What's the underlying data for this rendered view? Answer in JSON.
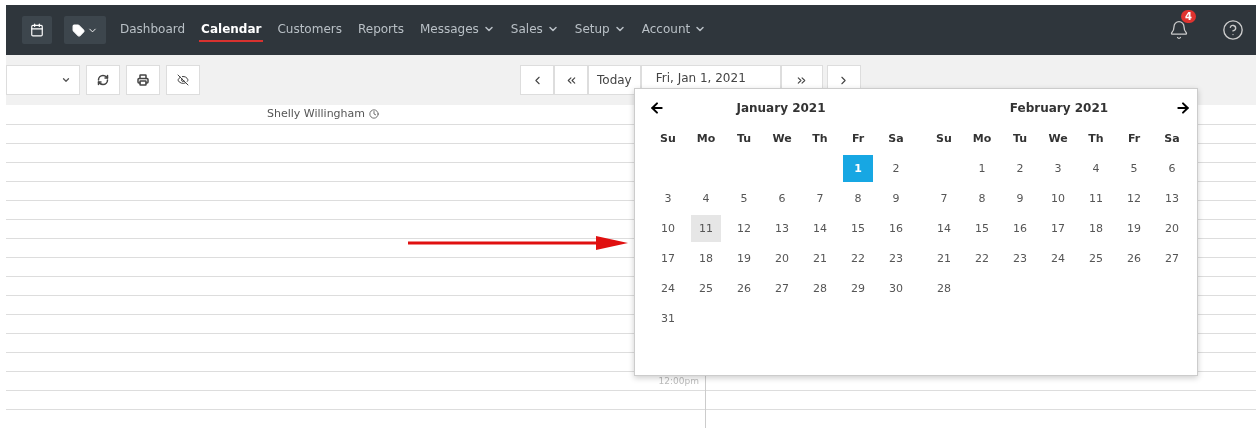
{
  "nav": {
    "items": [
      {
        "label": "Dashboard",
        "selected": false,
        "has_menu": false
      },
      {
        "label": "Calendar",
        "selected": true,
        "has_menu": false
      },
      {
        "label": "Customers",
        "selected": false,
        "has_menu": false
      },
      {
        "label": "Reports",
        "selected": false,
        "has_menu": false
      },
      {
        "label": "Messages",
        "selected": false,
        "has_menu": true
      },
      {
        "label": "Sales",
        "selected": false,
        "has_menu": true
      },
      {
        "label": "Setup",
        "selected": false,
        "has_menu": true
      },
      {
        "label": "Account",
        "selected": false,
        "has_menu": true
      }
    ],
    "notifications_badge": "4"
  },
  "toolbar": {
    "today_label": "Today",
    "date_value": "Fri, Jan 1, 2021"
  },
  "calendar": {
    "staff_name": "Shelly Willingham",
    "time_label": "12:00pm"
  },
  "datepicker": {
    "months": [
      {
        "title": "January 2021",
        "weekdays": [
          "Su",
          "Mo",
          "Tu",
          "We",
          "Th",
          "Fr",
          "Sa"
        ],
        "weeks": [
          [
            {
              "kind": "blank"
            },
            {
              "kind": "blank"
            },
            {
              "kind": "blank"
            },
            {
              "kind": "blank"
            },
            {
              "kind": "blank"
            },
            {
              "kind": "day",
              "day": "1",
              "selected": true,
              "hovered": false
            },
            {
              "kind": "day",
              "day": "2",
              "selected": false,
              "hovered": false
            }
          ],
          [
            {
              "kind": "day",
              "day": "3",
              "selected": false,
              "hovered": false
            },
            {
              "kind": "day",
              "day": "4",
              "selected": false,
              "hovered": false
            },
            {
              "kind": "day",
              "day": "5",
              "selected": false,
              "hovered": false
            },
            {
              "kind": "day",
              "day": "6",
              "selected": false,
              "hovered": false
            },
            {
              "kind": "day",
              "day": "7",
              "selected": false,
              "hovered": false
            },
            {
              "kind": "day",
              "day": "8",
              "selected": false,
              "hovered": false
            },
            {
              "kind": "day",
              "day": "9",
              "selected": false,
              "hovered": false
            }
          ],
          [
            {
              "kind": "day",
              "day": "10",
              "selected": false,
              "hovered": false
            },
            {
              "kind": "day",
              "day": "11",
              "selected": false,
              "hovered": true
            },
            {
              "kind": "day",
              "day": "12",
              "selected": false,
              "hovered": false
            },
            {
              "kind": "day",
              "day": "13",
              "selected": false,
              "hovered": false
            },
            {
              "kind": "day",
              "day": "14",
              "selected": false,
              "hovered": false
            },
            {
              "kind": "day",
              "day": "15",
              "selected": false,
              "hovered": false
            },
            {
              "kind": "day",
              "day": "16",
              "selected": false,
              "hovered": false
            }
          ],
          [
            {
              "kind": "day",
              "day": "17",
              "selected": false,
              "hovered": false
            },
            {
              "kind": "day",
              "day": "18",
              "selected": false,
              "hovered": false
            },
            {
              "kind": "day",
              "day": "19",
              "selected": false,
              "hovered": false
            },
            {
              "kind": "day",
              "day": "20",
              "selected": false,
              "hovered": false
            },
            {
              "kind": "day",
              "day": "21",
              "selected": false,
              "hovered": false
            },
            {
              "kind": "day",
              "day": "22",
              "selected": false,
              "hovered": false
            },
            {
              "kind": "day",
              "day": "23",
              "selected": false,
              "hovered": false
            }
          ],
          [
            {
              "kind": "day",
              "day": "24",
              "selected": false,
              "hovered": false
            },
            {
              "kind": "day",
              "day": "25",
              "selected": false,
              "hovered": false
            },
            {
              "kind": "day",
              "day": "26",
              "selected": false,
              "hovered": false
            },
            {
              "kind": "day",
              "day": "27",
              "selected": false,
              "hovered": false
            },
            {
              "kind": "day",
              "day": "28",
              "selected": false,
              "hovered": false
            },
            {
              "kind": "day",
              "day": "29",
              "selected": false,
              "hovered": false
            },
            {
              "kind": "day",
              "day": "30",
              "selected": false,
              "hovered": false
            }
          ],
          [
            {
              "kind": "day",
              "day": "31",
              "selected": false,
              "hovered": false
            }
          ]
        ]
      },
      {
        "title": "February 2021",
        "weekdays": [
          "Su",
          "Mo",
          "Tu",
          "We",
          "Th",
          "Fr",
          "Sa"
        ],
        "weeks": [
          [
            {
              "kind": "blank"
            },
            {
              "kind": "day",
              "day": "1",
              "selected": false,
              "hovered": false
            },
            {
              "kind": "day",
              "day": "2",
              "selected": false,
              "hovered": false
            },
            {
              "kind": "day",
              "day": "3",
              "selected": false,
              "hovered": false
            },
            {
              "kind": "day",
              "day": "4",
              "selected": false,
              "hovered": false
            },
            {
              "kind": "day",
              "day": "5",
              "selected": false,
              "hovered": false
            },
            {
              "kind": "day",
              "day": "6",
              "selected": false,
              "hovered": false
            }
          ],
          [
            {
              "kind": "day",
              "day": "7",
              "selected": false,
              "hovered": false
            },
            {
              "kind": "day",
              "day": "8",
              "selected": false,
              "hovered": false
            },
            {
              "kind": "day",
              "day": "9",
              "selected": false,
              "hovered": false
            },
            {
              "kind": "day",
              "day": "10",
              "selected": false,
              "hovered": false
            },
            {
              "kind": "day",
              "day": "11",
              "selected": false,
              "hovered": false
            },
            {
              "kind": "day",
              "day": "12",
              "selected": false,
              "hovered": false
            },
            {
              "kind": "day",
              "day": "13",
              "selected": false,
              "hovered": false
            }
          ],
          [
            {
              "kind": "day",
              "day": "14",
              "selected": false,
              "hovered": false
            },
            {
              "kind": "day",
              "day": "15",
              "selected": false,
              "hovered": false
            },
            {
              "kind": "day",
              "day": "16",
              "selected": false,
              "hovered": false
            },
            {
              "kind": "day",
              "day": "17",
              "selected": false,
              "hovered": false
            },
            {
              "kind": "day",
              "day": "18",
              "selected": false,
              "hovered": false
            },
            {
              "kind": "day",
              "day": "19",
              "selected": false,
              "hovered": false
            },
            {
              "kind": "day",
              "day": "20",
              "selected": false,
              "hovered": false
            }
          ],
          [
            {
              "kind": "day",
              "day": "21",
              "selected": false,
              "hovered": false
            },
            {
              "kind": "day",
              "day": "22",
              "selected": false,
              "hovered": false
            },
            {
              "kind": "day",
              "day": "23",
              "selected": false,
              "hovered": false
            },
            {
              "kind": "day",
              "day": "24",
              "selected": false,
              "hovered": false
            },
            {
              "kind": "day",
              "day": "25",
              "selected": false,
              "hovered": false
            },
            {
              "kind": "day",
              "day": "26",
              "selected": false,
              "hovered": false
            },
            {
              "kind": "day",
              "day": "27",
              "selected": false,
              "hovered": false
            }
          ],
          [
            {
              "kind": "day",
              "day": "28",
              "selected": false,
              "hovered": false
            }
          ]
        ]
      }
    ]
  }
}
